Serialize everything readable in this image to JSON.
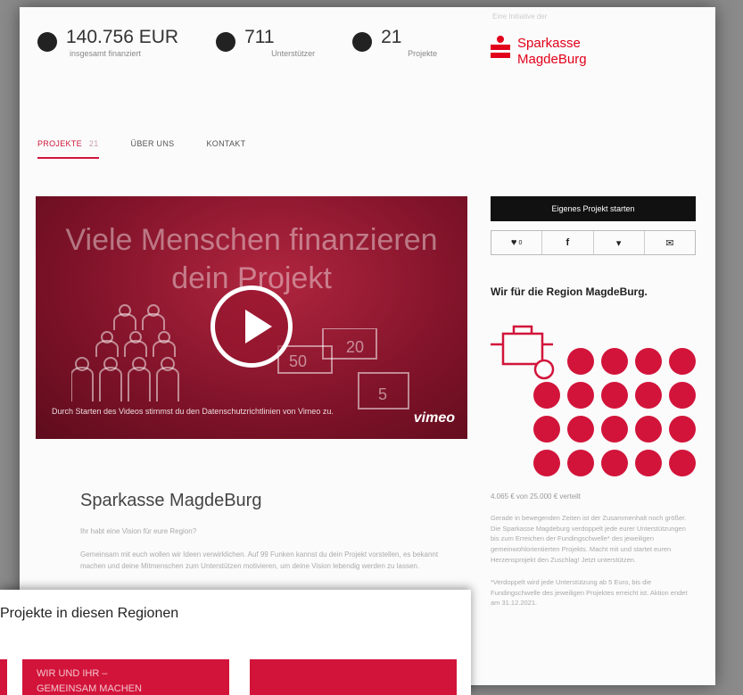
{
  "stats": [
    {
      "icon": "money-icon",
      "value": "140.756 EUR",
      "label": "insgesamt finanziert"
    },
    {
      "icon": "supporters-icon",
      "value": "711",
      "label": "Unterstützer"
    },
    {
      "icon": "projects-icon",
      "value": "21",
      "label": "Projekte"
    }
  ],
  "brand": {
    "caption": "Eine Initiative der",
    "name": "Sparkasse MagdeBurg"
  },
  "tabs": [
    {
      "label": "PROJEKTE",
      "count": "21"
    },
    {
      "label": "ÜBER UNS"
    },
    {
      "label": "KONTAKT"
    }
  ],
  "video": {
    "title_line1": "Viele Menschen finanzieren",
    "title_line2": "dein Projekt",
    "bill_values": [
      "50",
      "20",
      "5"
    ],
    "caption": "Durch Starten des Videos stimmst du den Datenschutzrichtlinien von Vimeo zu.",
    "brand": "vimeo"
  },
  "sidebar": {
    "start_button": "Eigenes Projekt starten",
    "share_count": "0",
    "heading": "Wir für die Region MagdeBurg.",
    "funding": "4.065 € von 25.000 € verteilt",
    "text1": "Gerade in bewegenden Zeiten ist der Zusammenhalt noch größer. Die Sparkasse Magdeburg verdoppelt jede eurer Unterstützungen bis zum Erreichen der Fundingschwelle* des jeweiligen gemeinwohlorientierten Projekts. Macht mit und startet euren Herzensprojekt den Zuschlag! Jetzt unterstützen.",
    "text2": "*Verdoppelt wird jede Unterstützung ab 5 Euro, bis die Fundingschwelle des jeweiligen Projektes erreicht ist. Aktion endet am 31.12.2021."
  },
  "project": {
    "title": "Sparkasse MagdeBurg",
    "question": "Ihr habt eine Vision für eure Region?",
    "description": "Gemeinsam mit euch wollen wir Ideen verwirklichen. Auf 99 Funken kannst du dein Projekt vorstellen, es bekannt machen und deine Mitmenschen zum Unterstützen motivieren, um deine Vision lebendig werden zu lassen."
  },
  "overlay": {
    "heading": "Projekte in diesen Regionen",
    "card_title_line1": "WIR UND IHR –",
    "card_title_line2": "GEMEINSAM MACHEN"
  },
  "colors": {
    "accent": "#d2143a",
    "brand": "#e2001a"
  }
}
